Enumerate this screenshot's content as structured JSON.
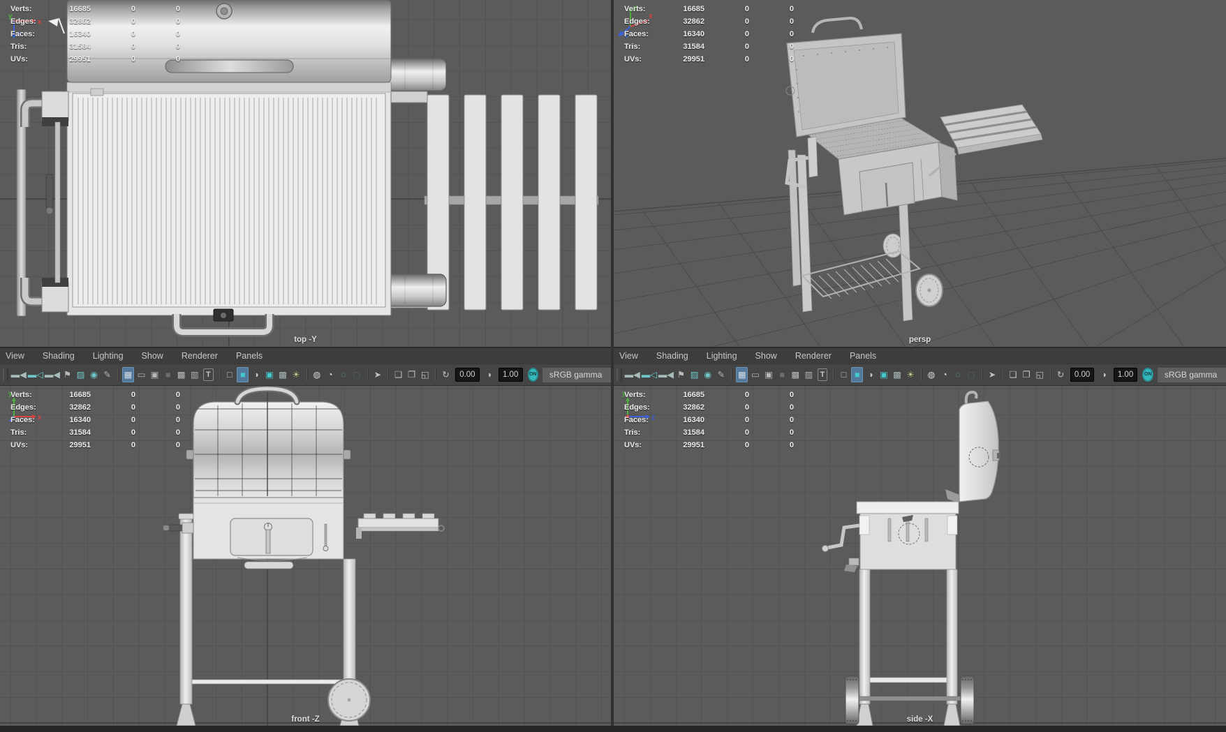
{
  "panels": {
    "top_left": {
      "label": "top -Y"
    },
    "top_right": {
      "label": "persp"
    },
    "bottom_left": {
      "label": "front -Z"
    },
    "bottom_right": {
      "label": "side -X"
    }
  },
  "hud": {
    "rows": [
      {
        "label": "Verts:",
        "value": "16685",
        "col2": "0",
        "col3": "0"
      },
      {
        "label": "Edges:",
        "value": "32862",
        "col2": "0",
        "col3": "0"
      },
      {
        "label": "Faces:",
        "value": "16340",
        "col2": "0",
        "col3": "0"
      },
      {
        "label": "Tris:",
        "value": "31584",
        "col2": "0",
        "col3": "0"
      },
      {
        "label": "UVs:",
        "value": "29951",
        "col2": "0",
        "col3": "0"
      }
    ]
  },
  "menu_items": [
    "View",
    "Shading",
    "Lighting",
    "Show",
    "Renderer",
    "Panels"
  ],
  "toolbar": {
    "items": [
      {
        "type": "handle"
      },
      {
        "type": "icon",
        "name": "select-camera-icon",
        "glyph": "▬◀",
        "color": "#a8bcbc"
      },
      {
        "type": "icon",
        "name": "lock-camera-icon",
        "glyph": "▬◁",
        "color": "#6ec6c8"
      },
      {
        "type": "icon",
        "name": "camera-attributes-icon",
        "glyph": "▬◀",
        "color": "#a8bcbc"
      },
      {
        "type": "icon",
        "name": "bookmark-icon",
        "glyph": "⚑",
        "color": "#b8b8b8"
      },
      {
        "type": "icon",
        "name": "image-plane-icon",
        "glyph": "▨",
        "color": "#6ec6c8"
      },
      {
        "type": "icon",
        "name": "pan-zoom-icon",
        "glyph": "◉",
        "color": "#6ec6c8"
      },
      {
        "type": "icon",
        "name": "grease-pencil-icon",
        "glyph": "✎",
        "color": "#b0b0b0"
      },
      {
        "type": "sep"
      },
      {
        "type": "icon",
        "name": "grid-icon",
        "glyph": "▦",
        "color": "#d3dde3",
        "active": true
      },
      {
        "type": "icon",
        "name": "film-gate-icon",
        "glyph": "▭",
        "color": "#b8b8b8"
      },
      {
        "type": "icon",
        "name": "resolution-gate-icon",
        "glyph": "▣",
        "color": "#b8b8b8"
      },
      {
        "type": "icon",
        "name": "gate-mask-icon",
        "glyph": "■",
        "color": "#9aa0a0",
        "disabled": true
      },
      {
        "type": "icon",
        "name": "field-chart-icon",
        "glyph": "▩",
        "color": "#b8b8b8"
      },
      {
        "type": "icon",
        "name": "safe-action-icon",
        "glyph": "▥",
        "color": "#b8b8b8"
      },
      {
        "type": "icon",
        "name": "safe-title-icon",
        "glyph": "T",
        "color": "#c4c4c4",
        "boxed": true
      },
      {
        "type": "sep"
      },
      {
        "type": "icon",
        "name": "wireframe-icon",
        "glyph": "□",
        "color": "#c0c0c0"
      },
      {
        "type": "icon",
        "name": "smooth-shade-icon",
        "glyph": "■",
        "color": "#45c8cc",
        "active": true
      },
      {
        "type": "icon",
        "name": "default-material-icon",
        "glyph": "◑",
        "color": "#c8c8c8"
      },
      {
        "type": "icon",
        "name": "textured-icon",
        "glyph": "▣",
        "color": "#45c8cc"
      },
      {
        "type": "icon",
        "name": "checkered-icon",
        "glyph": "▩",
        "color": "#a4b4b4"
      },
      {
        "type": "icon",
        "name": "lights-icon",
        "glyph": "☀",
        "color": "#cdc487"
      },
      {
        "type": "sep"
      },
      {
        "type": "icon",
        "name": "shadows-icon",
        "glyph": "◍",
        "color": "#d6d6d6"
      },
      {
        "type": "icon",
        "name": "ssao-icon",
        "glyph": "◔",
        "color": "#d6d6d6"
      },
      {
        "type": "icon",
        "name": "motion-blur-icon",
        "glyph": "◌",
        "color": "#6ec6c8"
      },
      {
        "type": "icon",
        "name": "anti-alias-icon",
        "glyph": "▢",
        "color": "#4d8c8e",
        "disabled": true
      },
      {
        "type": "sep"
      },
      {
        "type": "icon",
        "name": "selection-highlight-icon",
        "glyph": "➤",
        "color": "#c0c0c0"
      },
      {
        "type": "sep"
      },
      {
        "type": "icon",
        "name": "isolate-select-icon",
        "glyph": "❏",
        "color": "#c0c0c0"
      },
      {
        "type": "icon",
        "name": "isolate-add-icon",
        "glyph": "❐",
        "color": "#c0c0c0"
      },
      {
        "type": "icon",
        "name": "isolate-remove-icon",
        "glyph": "◱",
        "color": "#c0c0c0"
      },
      {
        "type": "sep"
      },
      {
        "type": "icon",
        "name": "exposure-icon",
        "glyph": "↻",
        "color": "#c0c0c0"
      },
      {
        "type": "field",
        "name": "exposure-field",
        "value": "0.00"
      },
      {
        "type": "icon",
        "name": "contrast-icon",
        "glyph": "◑",
        "color": "#c0c0c0"
      },
      {
        "type": "field",
        "name": "contrast-field",
        "value": "1.00"
      },
      {
        "type": "toggle",
        "name": "gamma-toggle",
        "value": "ON"
      },
      {
        "type": "label",
        "name": "gamma-label",
        "value": "sRGB gamma"
      }
    ]
  },
  "gizmo": {
    "x": "x",
    "y": "y",
    "z": "z"
  },
  "colors": {
    "viewport_bg": "#5b5b5b",
    "grid_line": "#4b4b4b",
    "axis_line": "#3e3e3e",
    "menubar_bg": "#3d3d3d",
    "toolbar_bg": "#454545",
    "accent_teal": "#45c8cc",
    "active_button_bg": "#52799c",
    "model_light": "#e4e4e4",
    "model_stroke": "#8a8a8a",
    "axis_x": "#d94040",
    "axis_y": "#4fae3c",
    "axis_z": "#3b62d9"
  }
}
